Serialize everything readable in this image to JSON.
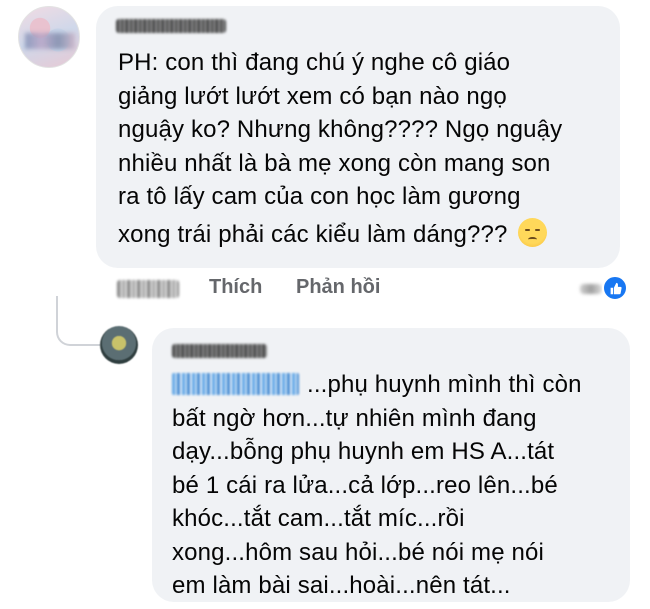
{
  "comments": [
    {
      "avatar_icon": "user-avatar-icon",
      "text_lines": [
        "PH: con thì đang chú ý nghe cô giáo",
        "giảng lướt lướt xem có bạn nào ngọ",
        "nguậy ko? Nhưng không???? Ngọ nguậy",
        "nhiều nhất là bà mẹ xong còn mang son",
        "ra tô lấy cam của con học làm gương",
        "xong trái phải các kiểu làm dáng???"
      ],
      "emoji_icon": "pensive-face-icon",
      "actions": {
        "like_label": "Thích",
        "reply_label": "Phản hồi"
      },
      "reaction_icon": "like-thumb-icon"
    },
    {
      "avatar_icon": "user-avatar-icon",
      "text_lines": [
        "...phụ huynh mình thì còn",
        "bất ngờ hơn...tự nhiên mình đang",
        "dạy...bỗng phụ huynh em HS A...tát",
        "bé 1 cái ra lửa...cả lớp...reo lên...bé",
        "khóc...tắt cam...tắt míc...rồi",
        "xong...hôm sau hỏi...bé nói mẹ nói",
        "em làm bài sai...hoài...nên tát..."
      ]
    }
  ],
  "colors": {
    "bubble_bg": "#f0f2f5",
    "action_text": "#65676b",
    "like_blue": "#1877f2"
  }
}
